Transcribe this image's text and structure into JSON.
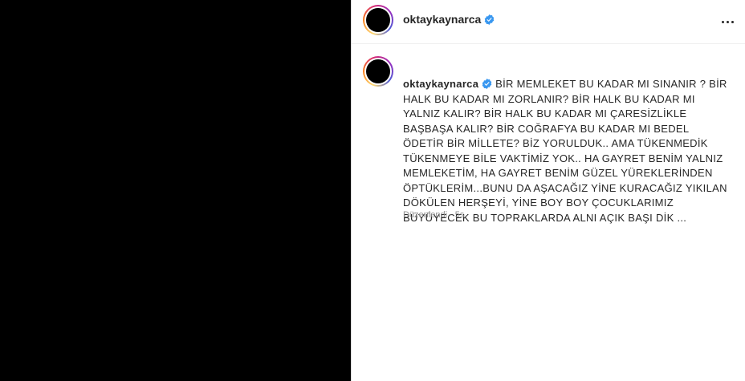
{
  "post": {
    "username": "oktaykaynarca",
    "verified_icon": "verified-badge-icon",
    "more_icon": "more-options-icon",
    "accent_color": "#3897f0",
    "caption": "BİR MEMLEKET BU KADAR MI SINANIR ? BİR HALK BU KADAR MI ZORLANIR? BİR HALK BU KADAR MI YALNIZ KALIR? BİR HALK BU KADAR MI ÇARESİZLİKLE BAŞBAŞA KALIR? BİR COĞRAFYA BU KADAR MI BEDEL ÖDETİR BİR MİLLETE? BİZ YORULDUK.. AMA TÜKENMEDİK TÜKENMEYE BİLE VAKTİMİZ YOK.. HA GAYRET BENİM YALNIZ MEMLEKETİM, HA GAYRET BENİM GÜZEL YÜREKLERİNDEN ÖPTÜKLERİM...BUNU DA AŞACAĞIZ YİNE KURACAĞIZ YIKILAN DÖKÜLEN HERŞEYİ, YİNE BOY BOY ÇOCUKLARIMIZ BÜYÜYECEK BU TOPRAKLARDA ALNI AÇIK BAŞI DİK ...",
    "edited_label": "Düzenlendi",
    "separator": "·",
    "time_ago": "5s"
  }
}
